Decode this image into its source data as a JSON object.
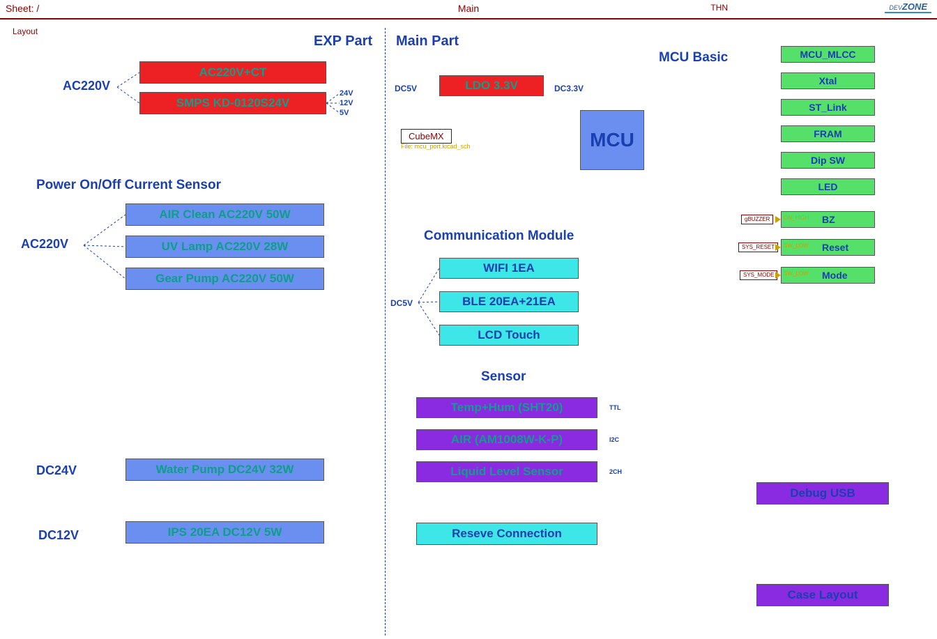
{
  "header": {
    "sheet": "Sheet: /",
    "main": "Main",
    "thn": "THN",
    "logo_small": "DEV",
    "logo_big": "ZONE"
  },
  "layout_label": "Layout",
  "exp": {
    "title": "EXP Part",
    "ac220v_lbl": "AC220V",
    "ac_ct": "AC220V+CT",
    "smps": "SMPS KD-0120S24V",
    "volts": {
      "v24": "24V",
      "v12": "12V",
      "v5": "5V"
    },
    "pocs_title": "Power On/Off Current Sensor",
    "ac220v_lbl2": "AC220V",
    "pocs": {
      "air": "AIR Clean AC220V 50W",
      "uv": "UV Lamp AC220V 28W",
      "gear": "Gear Pump AC220V 50W"
    },
    "dc24v_lbl": "DC24V",
    "water": "Water Pump DC24V 32W",
    "dc12v_lbl": "DC12V",
    "ips": "IPS 20EA DC12V 5W"
  },
  "main": {
    "title": "Main Part",
    "dc5v_lbl": "DC5V",
    "ldo": "LDO 3.3V",
    "dc33v_lbl": "DC3.3V",
    "cubemx": "CubeMX",
    "cubemx_file": "File: mcu_port.kicad_sch",
    "mcu": "MCU",
    "comm_title": "Communication Module",
    "dc5v_lbl2": "DC5V",
    "comm": {
      "wifi": "WIFI 1EA",
      "ble": "BLE 20EA+21EA",
      "lcd": "LCD Touch"
    },
    "sensor_title": "Sensor",
    "sensor": {
      "temp": "Temp+Hum (SHT20)",
      "air": "AIR (AM1008W-K-P)",
      "liquid": "Liquid Level Sensor"
    },
    "sensor_bus": {
      "ttl": "TTL",
      "i2c": "I2C",
      "ch2": "2CH"
    },
    "reserve": "Reseve Connection"
  },
  "mcu_basic": {
    "title": "MCU Basic",
    "items": {
      "mlcc": "MCU_MLCC",
      "xtal": "Xtal",
      "stlink": "ST_Link",
      "fram": "FRAM",
      "dipsw": "Dip SW",
      "led": "LED",
      "bz": "BZ",
      "reset": "Reset",
      "mode": "Mode"
    },
    "nets": {
      "buzzer": "gBUZZER",
      "sys_reset": "SYS_RESET",
      "sys_mode": "SYS_MODE",
      "on_high": "ON_HIGH",
      "sw_low1": "SW_LOW",
      "sw_low2": "SW_LOW"
    }
  },
  "bottom": {
    "debug": "Debug USB",
    "case": "Case Layout"
  }
}
